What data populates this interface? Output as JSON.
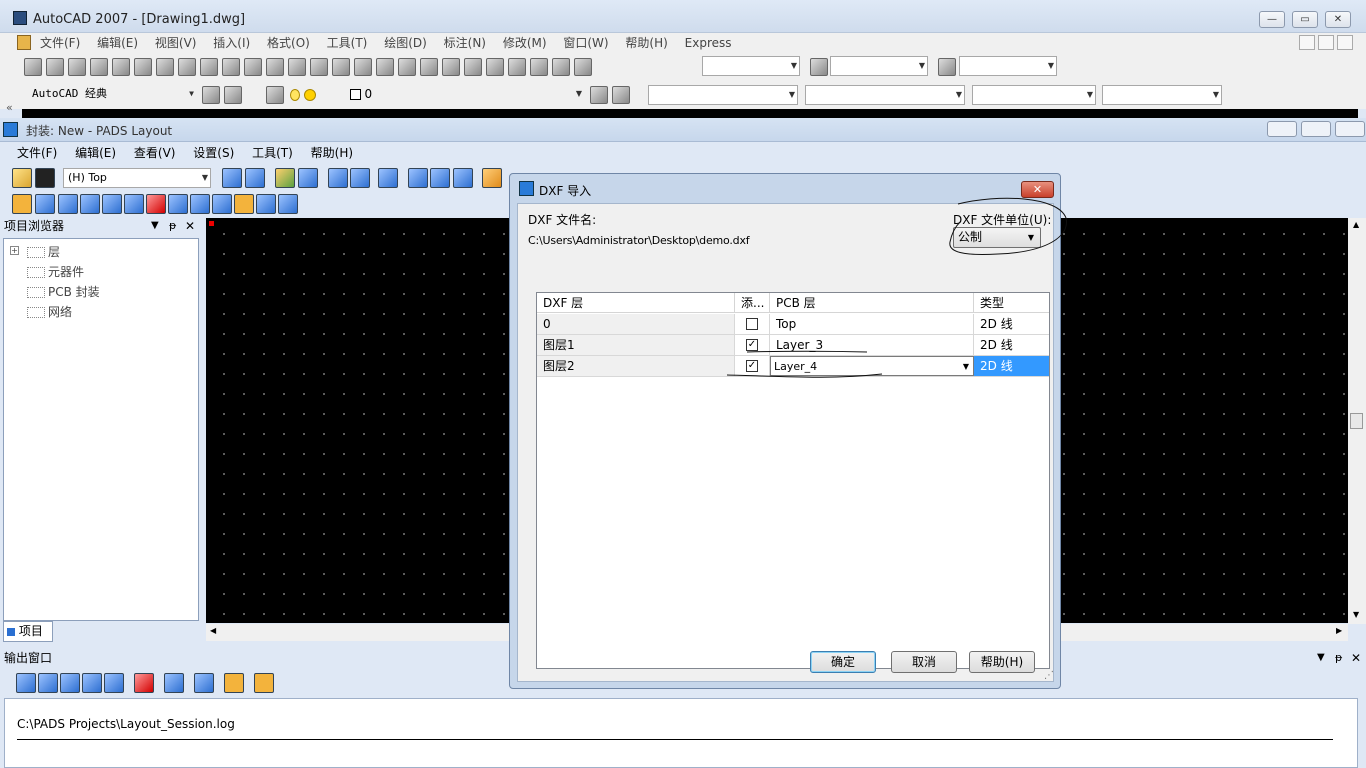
{
  "autocad": {
    "title": "AutoCAD 2007 - [Drawing1.dwg]",
    "menu": [
      "文件(F)",
      "编辑(E)",
      "视图(V)",
      "插入(I)",
      "格式(O)",
      "工具(T)",
      "绘图(D)",
      "标注(N)",
      "修改(M)",
      "窗口(W)",
      "帮助(H)",
      "Express"
    ],
    "workspace": "AutoCAD 经典",
    "layer_value": "0",
    "collapse_glyph": "«"
  },
  "pads": {
    "title": "封装: New - PADS Layout",
    "menu": [
      "文件(F)",
      "编辑(E)",
      "查看(V)",
      "设置(S)",
      "工具(T)",
      "帮助(H)"
    ],
    "layer_combo": "(H) Top",
    "project_browser": {
      "title": "项目浏览器",
      "items": [
        "层",
        "元器件",
        "PCB 封装",
        "网络"
      ],
      "tab_label": "项目"
    },
    "output": {
      "title": "输出窗口",
      "log_path": "C:\\PADS Projects\\Layout_Session.log"
    }
  },
  "dialog": {
    "title": "DXF 导入",
    "filename_label": "DXF 文件名:",
    "filename_value": "C:\\Users\\Administrator\\Desktop\\demo.dxf",
    "unit_label": "DXF 文件单位(U):",
    "unit_value": "公制",
    "columns": [
      "DXF 层",
      "添...",
      "PCB 层",
      "类型"
    ],
    "rows": [
      {
        "dxf": "0",
        "checked": false,
        "pcb": "Top",
        "type": "2D 线"
      },
      {
        "dxf": "图层1",
        "checked": true,
        "pcb": "Layer_3",
        "type": "2D 线"
      },
      {
        "dxf": "图层2",
        "checked": true,
        "pcb": "Layer_4",
        "type": "2D 线"
      }
    ],
    "ok": "确定",
    "cancel": "取消",
    "help": "帮助(H)"
  }
}
